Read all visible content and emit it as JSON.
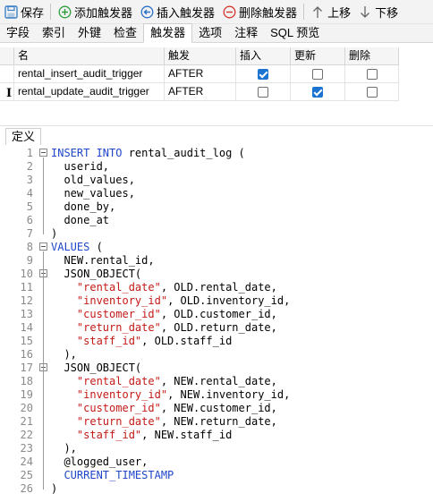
{
  "toolbar": {
    "save": "保存",
    "add_trigger": "添加触发器",
    "insert_trigger": "插入触发器",
    "delete_trigger": "删除触发器",
    "move_up": "上移",
    "move_down": "下移",
    "colors": {
      "add": "#2e9e3b",
      "insert": "#2a6fc9",
      "delete": "#d8322c",
      "save": "#3c7fc6"
    }
  },
  "tabs": [
    "字段",
    "索引",
    "外键",
    "检查",
    "触发器",
    "选项",
    "注释",
    "SQL 预览"
  ],
  "active_tab": "触发器",
  "grid": {
    "headers": {
      "name": "名",
      "fire": "触发",
      "insert": "插入",
      "update": "更新",
      "delete": "删除"
    },
    "rows": [
      {
        "name": "rental_insert_audit_trigger",
        "fire": "AFTER",
        "insert": true,
        "update": false,
        "delete": false
      },
      {
        "name": "rental_update_audit_trigger",
        "fire": "AFTER",
        "insert": false,
        "update": true,
        "delete": false
      }
    ]
  },
  "definition_tab": "定义",
  "code_lines": [
    [
      {
        "t": "INSERT INTO",
        "c": "kw"
      },
      {
        "t": " rental_audit_log (",
        "c": ""
      }
    ],
    [
      {
        "t": "  userid,",
        "c": ""
      }
    ],
    [
      {
        "t": "  old_values,",
        "c": ""
      }
    ],
    [
      {
        "t": "  new_values,",
        "c": ""
      }
    ],
    [
      {
        "t": "  done_by,",
        "c": ""
      }
    ],
    [
      {
        "t": "  done_at",
        "c": ""
      }
    ],
    [
      {
        "t": ")",
        "c": ""
      }
    ],
    [
      {
        "t": "VALUES",
        "c": "kw"
      },
      {
        "t": " (",
        "c": ""
      }
    ],
    [
      {
        "t": "  NEW.rental_id,",
        "c": ""
      }
    ],
    [
      {
        "t": "  JSON_OBJECT(",
        "c": ""
      }
    ],
    [
      {
        "t": "    ",
        "c": ""
      },
      {
        "t": "\"rental_date\"",
        "c": "str"
      },
      {
        "t": ", OLD.rental_date,",
        "c": ""
      }
    ],
    [
      {
        "t": "    ",
        "c": ""
      },
      {
        "t": "\"inventory_id\"",
        "c": "str"
      },
      {
        "t": ", OLD.inventory_id,",
        "c": ""
      }
    ],
    [
      {
        "t": "    ",
        "c": ""
      },
      {
        "t": "\"customer_id\"",
        "c": "str"
      },
      {
        "t": ", OLD.customer_id,",
        "c": ""
      }
    ],
    [
      {
        "t": "    ",
        "c": ""
      },
      {
        "t": "\"return_date\"",
        "c": "str"
      },
      {
        "t": ", OLD.return_date,",
        "c": ""
      }
    ],
    [
      {
        "t": "    ",
        "c": ""
      },
      {
        "t": "\"staff_id\"",
        "c": "str"
      },
      {
        "t": ", OLD.staff_id",
        "c": ""
      }
    ],
    [
      {
        "t": "  ),",
        "c": ""
      }
    ],
    [
      {
        "t": "  JSON_OBJECT(",
        "c": ""
      }
    ],
    [
      {
        "t": "    ",
        "c": ""
      },
      {
        "t": "\"rental_date\"",
        "c": "str"
      },
      {
        "t": ", NEW.rental_date,",
        "c": ""
      }
    ],
    [
      {
        "t": "    ",
        "c": ""
      },
      {
        "t": "\"inventory_id\"",
        "c": "str"
      },
      {
        "t": ", NEW.inventory_id,",
        "c": ""
      }
    ],
    [
      {
        "t": "    ",
        "c": ""
      },
      {
        "t": "\"customer_id\"",
        "c": "str"
      },
      {
        "t": ", NEW.customer_id,",
        "c": ""
      }
    ],
    [
      {
        "t": "    ",
        "c": ""
      },
      {
        "t": "\"return_date\"",
        "c": "str"
      },
      {
        "t": ", NEW.return_date,",
        "c": ""
      }
    ],
    [
      {
        "t": "    ",
        "c": ""
      },
      {
        "t": "\"staff_id\"",
        "c": "str"
      },
      {
        "t": ", NEW.staff_id",
        "c": ""
      }
    ],
    [
      {
        "t": "  ),",
        "c": ""
      }
    ],
    [
      {
        "t": "  @logged_user,",
        "c": ""
      }
    ],
    [
      {
        "t": "  ",
        "c": ""
      },
      {
        "t": "CURRENT_TIMESTAMP",
        "c": "kw"
      }
    ],
    [
      {
        "t": ")",
        "c": ""
      }
    ]
  ],
  "fold_lines": [
    1,
    8,
    10,
    17
  ]
}
